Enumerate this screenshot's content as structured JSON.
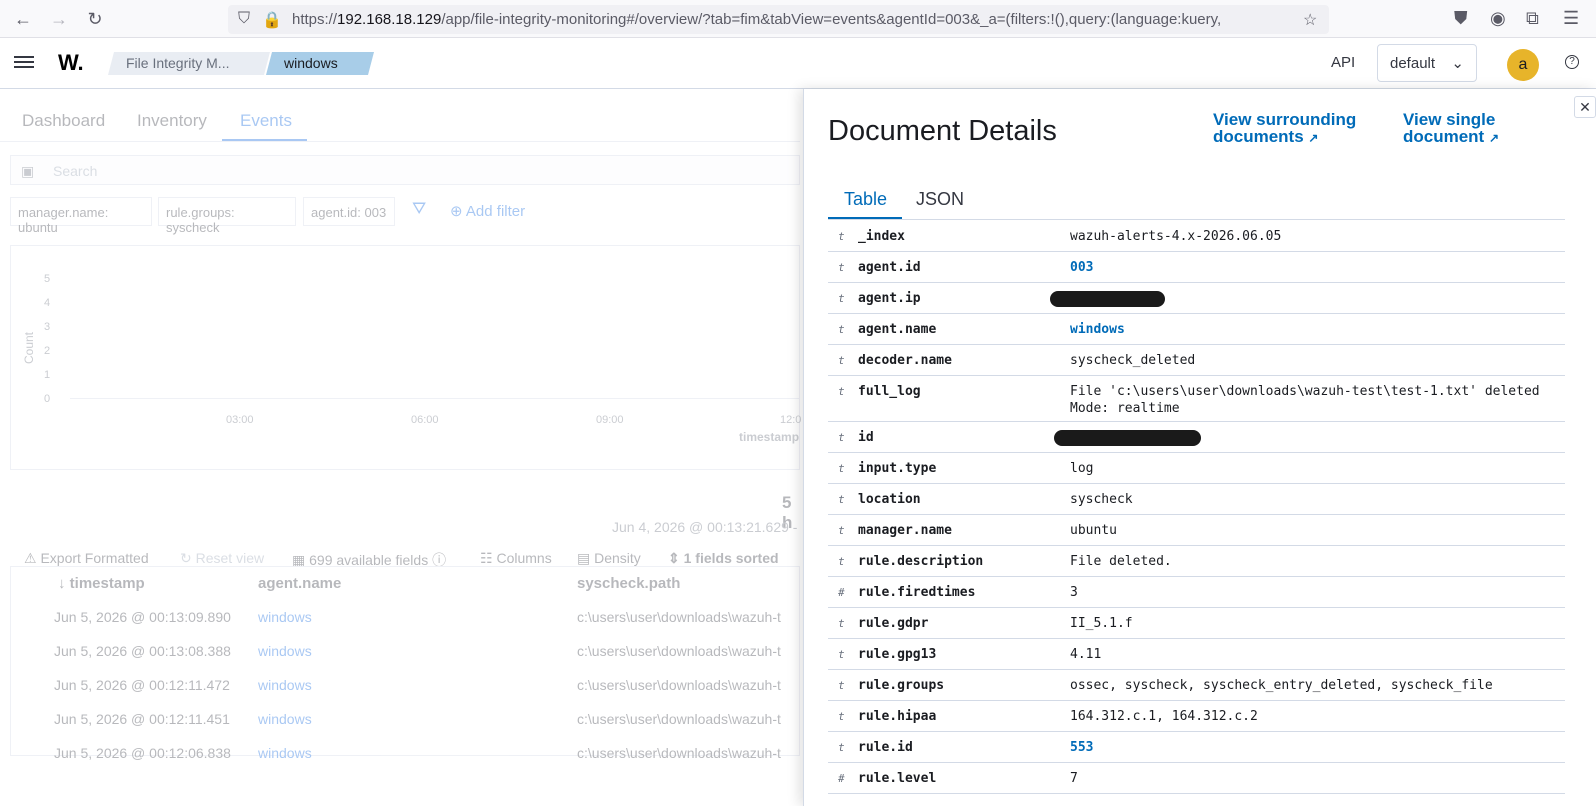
{
  "browser": {
    "url_prefix": "https://",
    "url_host": "192.168.18.129",
    "url_path": "/app/file-integrity-monitoring#/overview/?tab=fim&tabView=events&agentId=003&_a=(filters:!(),query:(language:kuery,"
  },
  "header": {
    "logo": "W.",
    "breadcrumbs": [
      "File Integrity M...",
      "windows"
    ],
    "api_label": "API",
    "space_select": "default",
    "avatar_initial": "a"
  },
  "background": {
    "tabs": [
      "Dashboard",
      "Inventory",
      "Events"
    ],
    "search_placeholder": "Search",
    "filters": [
      "manager.name: ubuntu",
      "rule.groups: syscheck",
      "agent.id: 003"
    ],
    "add_filter": "Add filter",
    "chart_yticks": [
      "5",
      "4",
      "3",
      "2",
      "1",
      "0"
    ],
    "chart_xticks": [
      "03:00",
      "06:00",
      "09:00",
      "12:0"
    ],
    "chart_ylabel": "Count",
    "chart_xlabel": "timestamp",
    "hits": "5 h",
    "date_range": "Jun 4, 2026 @ 00:13:21.629 -",
    "toolbar": [
      "Export Formatted",
      "Reset view",
      "699 available fields",
      "Columns",
      "Density",
      "1 fields sorted"
    ],
    "columns": [
      "timestamp",
      "agent.name",
      "syscheck.path"
    ],
    "rows": [
      {
        "timestamp": "Jun 5, 2026 @ 00:13:09.890",
        "agent": "windows",
        "path": "c:\\users\\user\\downloads\\wazuh-t"
      },
      {
        "timestamp": "Jun 5, 2026 @ 00:13:08.388",
        "agent": "windows",
        "path": "c:\\users\\user\\downloads\\wazuh-t"
      },
      {
        "timestamp": "Jun 5, 2026 @ 00:12:11.472",
        "agent": "windows",
        "path": "c:\\users\\user\\downloads\\wazuh-t"
      },
      {
        "timestamp": "Jun 5, 2026 @ 00:12:11.451",
        "agent": "windows",
        "path": "c:\\users\\user\\downloads\\wazuh-t"
      },
      {
        "timestamp": "Jun 5, 2026 @ 00:12:06.838",
        "agent": "windows",
        "path": "c:\\users\\user\\downloads\\wazuh-t"
      }
    ]
  },
  "flyout": {
    "title": "Document Details",
    "link_surrounding": "View surrounding documents",
    "link_single": "View single document",
    "tabs": [
      "Table",
      "JSON"
    ],
    "fields": [
      {
        "type": "t",
        "key": "_index",
        "value": "wazuh-alerts-4.x-2026.06.05",
        "link": false
      },
      {
        "type": "t",
        "key": "agent.id",
        "value": "003",
        "link": true
      },
      {
        "type": "t",
        "key": "agent.ip",
        "value": "",
        "link": false,
        "redacted": true
      },
      {
        "type": "t",
        "key": "agent.name",
        "value": "windows",
        "link": true
      },
      {
        "type": "t",
        "key": "decoder.name",
        "value": "syscheck_deleted",
        "link": false
      },
      {
        "type": "t",
        "key": "full_log",
        "value": "File 'c:\\users\\user\\downloads\\wazuh-test\\test-1.txt' deleted\nMode: realtime",
        "link": false
      },
      {
        "type": "t",
        "key": "id",
        "value": "",
        "link": false,
        "redacted": true
      },
      {
        "type": "t",
        "key": "input.type",
        "value": "log",
        "link": false
      },
      {
        "type": "t",
        "key": "location",
        "value": "syscheck",
        "link": false
      },
      {
        "type": "t",
        "key": "manager.name",
        "value": "ubuntu",
        "link": false
      },
      {
        "type": "t",
        "key": "rule.description",
        "value": "File deleted.",
        "link": false
      },
      {
        "type": "#",
        "key": "rule.firedtimes",
        "value": "3",
        "link": false
      },
      {
        "type": "t",
        "key": "rule.gdpr",
        "value": "II_5.1.f",
        "link": false
      },
      {
        "type": "t",
        "key": "rule.gpg13",
        "value": "4.11",
        "link": false
      },
      {
        "type": "t",
        "key": "rule.groups",
        "value": "ossec, syscheck, syscheck_entry_deleted, syscheck_file",
        "link": false
      },
      {
        "type": "t",
        "key": "rule.hipaa",
        "value": "164.312.c.1, 164.312.c.2",
        "link": false
      },
      {
        "type": "t",
        "key": "rule.id",
        "value": "553",
        "link": true
      },
      {
        "type": "#",
        "key": "rule.level",
        "value": "7",
        "link": false
      }
    ]
  }
}
